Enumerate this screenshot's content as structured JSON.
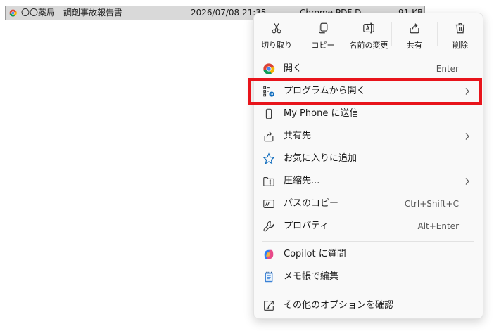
{
  "file": {
    "name": "〇〇薬局　調剤事故報告書",
    "date": "2026/07/08 21:35",
    "type_partial": "Chrome PDF D",
    "size_partial": "91 KB"
  },
  "quick_actions": [
    {
      "label": "切り取り",
      "icon": "scissors-icon"
    },
    {
      "label": "コピー",
      "icon": "copy-icon"
    },
    {
      "label": "名前の変更",
      "icon": "rename-icon"
    },
    {
      "label": "共有",
      "icon": "share-icon"
    },
    {
      "label": "削除",
      "icon": "trash-icon"
    }
  ],
  "menu_items": [
    {
      "label": "開く",
      "shortcut": "Enter",
      "icon": "chrome-icon"
    },
    {
      "label": "プログラムから開く",
      "submenu": true,
      "icon": "open-with-icon"
    },
    {
      "label": "My Phone に送信",
      "icon": "phone-icon"
    },
    {
      "label": "共有先",
      "submenu": true,
      "icon": "share-icon"
    },
    {
      "label": "お気に入りに追加",
      "icon": "star-icon"
    },
    {
      "label": "圧縮先...",
      "submenu": true,
      "icon": "zip-folder-icon"
    },
    {
      "label": "パスのコピー",
      "shortcut": "Ctrl+Shift+C",
      "icon": "path-icon"
    },
    {
      "label": "プロパティ",
      "shortcut": "Alt+Enter",
      "icon": "wrench-icon"
    },
    {
      "label": "Copilot に質問",
      "icon": "copilot-icon"
    },
    {
      "label": "メモ帳で編集",
      "icon": "notepad-icon"
    },
    {
      "label": "その他のオプションを確認",
      "icon": "more-options-icon"
    }
  ],
  "colors": {
    "highlight_border": "#e8141b",
    "menu_background": "#f9f9f9",
    "selected_row": "#d9d9d9"
  }
}
